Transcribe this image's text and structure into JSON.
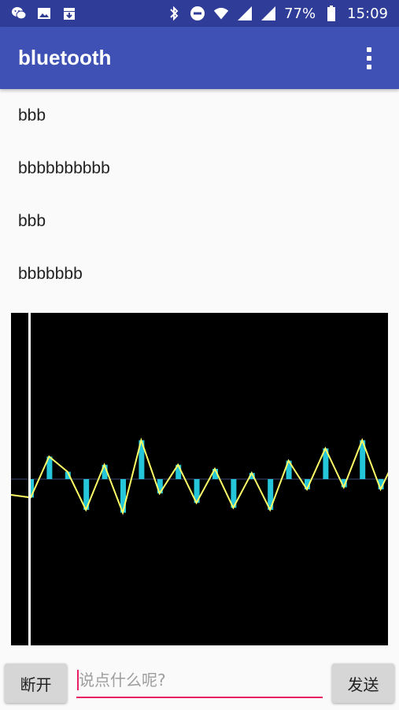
{
  "status_bar": {
    "battery": "77%",
    "time": "15:09",
    "icons": [
      "wechat-icon",
      "image-icon",
      "download-icon",
      "bluetooth-icon",
      "do-not-disturb-icon",
      "wifi-icon",
      "signal-icon",
      "signal-icon-2",
      "battery-icon"
    ]
  },
  "app_bar": {
    "title": "bluetooth"
  },
  "messages": [
    {
      "text": "bbb"
    },
    {
      "text": "bbbbbbbbbb"
    },
    {
      "text": "bbb"
    },
    {
      "text": "bbbbbbb"
    }
  ],
  "waveform": {
    "description_colors": {
      "background": "#000000",
      "bars": "#26c6da",
      "line": "#ffff66",
      "cursor": "#ffffff"
    },
    "samples": [
      -0.45,
      0.55,
      0.18,
      -0.75,
      0.35,
      -0.82,
      0.95,
      -0.35,
      0.35,
      -0.58,
      0.25,
      -0.7,
      0.15,
      -0.75,
      0.45,
      -0.25,
      0.75,
      -0.2,
      0.95,
      -0.25,
      0.7
    ]
  },
  "composer": {
    "disconnect_label": "断开",
    "input_placeholder": "说点什么呢?",
    "input_value": "",
    "send_label": "发送"
  }
}
